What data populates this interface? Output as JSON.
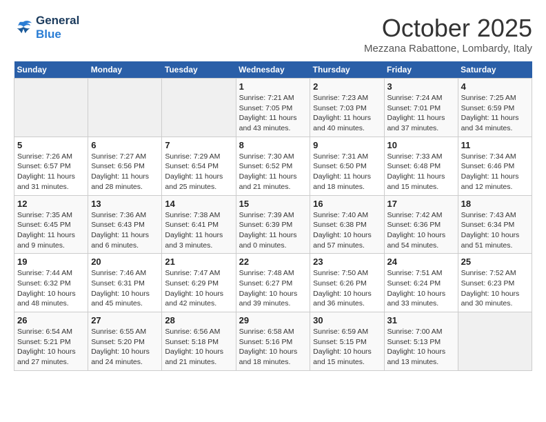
{
  "logo": {
    "line1": "General",
    "line2": "Blue"
  },
  "title": "October 2025",
  "subtitle": "Mezzana Rabattone, Lombardy, Italy",
  "days_of_week": [
    "Sunday",
    "Monday",
    "Tuesday",
    "Wednesday",
    "Thursday",
    "Friday",
    "Saturday"
  ],
  "weeks": [
    [
      {
        "day": "",
        "info": ""
      },
      {
        "day": "",
        "info": ""
      },
      {
        "day": "",
        "info": ""
      },
      {
        "day": "1",
        "info": "Sunrise: 7:21 AM\nSunset: 7:05 PM\nDaylight: 11 hours\nand 43 minutes."
      },
      {
        "day": "2",
        "info": "Sunrise: 7:23 AM\nSunset: 7:03 PM\nDaylight: 11 hours\nand 40 minutes."
      },
      {
        "day": "3",
        "info": "Sunrise: 7:24 AM\nSunset: 7:01 PM\nDaylight: 11 hours\nand 37 minutes."
      },
      {
        "day": "4",
        "info": "Sunrise: 7:25 AM\nSunset: 6:59 PM\nDaylight: 11 hours\nand 34 minutes."
      }
    ],
    [
      {
        "day": "5",
        "info": "Sunrise: 7:26 AM\nSunset: 6:57 PM\nDaylight: 11 hours\nand 31 minutes."
      },
      {
        "day": "6",
        "info": "Sunrise: 7:27 AM\nSunset: 6:56 PM\nDaylight: 11 hours\nand 28 minutes."
      },
      {
        "day": "7",
        "info": "Sunrise: 7:29 AM\nSunset: 6:54 PM\nDaylight: 11 hours\nand 25 minutes."
      },
      {
        "day": "8",
        "info": "Sunrise: 7:30 AM\nSunset: 6:52 PM\nDaylight: 11 hours\nand 21 minutes."
      },
      {
        "day": "9",
        "info": "Sunrise: 7:31 AM\nSunset: 6:50 PM\nDaylight: 11 hours\nand 18 minutes."
      },
      {
        "day": "10",
        "info": "Sunrise: 7:33 AM\nSunset: 6:48 PM\nDaylight: 11 hours\nand 15 minutes."
      },
      {
        "day": "11",
        "info": "Sunrise: 7:34 AM\nSunset: 6:46 PM\nDaylight: 11 hours\nand 12 minutes."
      }
    ],
    [
      {
        "day": "12",
        "info": "Sunrise: 7:35 AM\nSunset: 6:45 PM\nDaylight: 11 hours\nand 9 minutes."
      },
      {
        "day": "13",
        "info": "Sunrise: 7:36 AM\nSunset: 6:43 PM\nDaylight: 11 hours\nand 6 minutes."
      },
      {
        "day": "14",
        "info": "Sunrise: 7:38 AM\nSunset: 6:41 PM\nDaylight: 11 hours\nand 3 minutes."
      },
      {
        "day": "15",
        "info": "Sunrise: 7:39 AM\nSunset: 6:39 PM\nDaylight: 11 hours\nand 0 minutes."
      },
      {
        "day": "16",
        "info": "Sunrise: 7:40 AM\nSunset: 6:38 PM\nDaylight: 10 hours\nand 57 minutes."
      },
      {
        "day": "17",
        "info": "Sunrise: 7:42 AM\nSunset: 6:36 PM\nDaylight: 10 hours\nand 54 minutes."
      },
      {
        "day": "18",
        "info": "Sunrise: 7:43 AM\nSunset: 6:34 PM\nDaylight: 10 hours\nand 51 minutes."
      }
    ],
    [
      {
        "day": "19",
        "info": "Sunrise: 7:44 AM\nSunset: 6:32 PM\nDaylight: 10 hours\nand 48 minutes."
      },
      {
        "day": "20",
        "info": "Sunrise: 7:46 AM\nSunset: 6:31 PM\nDaylight: 10 hours\nand 45 minutes."
      },
      {
        "day": "21",
        "info": "Sunrise: 7:47 AM\nSunset: 6:29 PM\nDaylight: 10 hours\nand 42 minutes."
      },
      {
        "day": "22",
        "info": "Sunrise: 7:48 AM\nSunset: 6:27 PM\nDaylight: 10 hours\nand 39 minutes."
      },
      {
        "day": "23",
        "info": "Sunrise: 7:50 AM\nSunset: 6:26 PM\nDaylight: 10 hours\nand 36 minutes."
      },
      {
        "day": "24",
        "info": "Sunrise: 7:51 AM\nSunset: 6:24 PM\nDaylight: 10 hours\nand 33 minutes."
      },
      {
        "day": "25",
        "info": "Sunrise: 7:52 AM\nSunset: 6:23 PM\nDaylight: 10 hours\nand 30 minutes."
      }
    ],
    [
      {
        "day": "26",
        "info": "Sunrise: 6:54 AM\nSunset: 5:21 PM\nDaylight: 10 hours\nand 27 minutes."
      },
      {
        "day": "27",
        "info": "Sunrise: 6:55 AM\nSunset: 5:20 PM\nDaylight: 10 hours\nand 24 minutes."
      },
      {
        "day": "28",
        "info": "Sunrise: 6:56 AM\nSunset: 5:18 PM\nDaylight: 10 hours\nand 21 minutes."
      },
      {
        "day": "29",
        "info": "Sunrise: 6:58 AM\nSunset: 5:16 PM\nDaylight: 10 hours\nand 18 minutes."
      },
      {
        "day": "30",
        "info": "Sunrise: 6:59 AM\nSunset: 5:15 PM\nDaylight: 10 hours\nand 15 minutes."
      },
      {
        "day": "31",
        "info": "Sunrise: 7:00 AM\nSunset: 5:13 PM\nDaylight: 10 hours\nand 13 minutes."
      },
      {
        "day": "",
        "info": ""
      }
    ]
  ]
}
